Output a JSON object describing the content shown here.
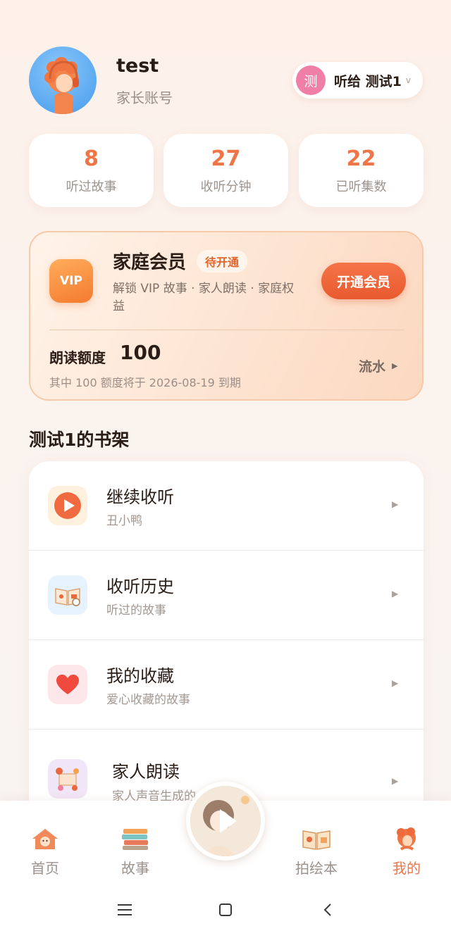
{
  "profile": {
    "username": "test",
    "account_type": "家长账号",
    "listen_to": {
      "avatar_char": "测",
      "label": "听给 测试1"
    }
  },
  "stats": [
    {
      "value": "8",
      "label": "听过故事"
    },
    {
      "value": "27",
      "label": "收听分钟"
    },
    {
      "value": "22",
      "label": "已听集数"
    }
  ],
  "vip": {
    "badge": "VIP",
    "title": "家庭会员",
    "status_tag": "待开通",
    "description": "解锁 VIP 故事 · 家人朗读 · 家庭权益",
    "button": "开通会员",
    "quota_label": "朗读额度",
    "quota_value": "100",
    "quota_note": "其中 100 额度将于 2026-08-19 到期",
    "flow_link": "流水"
  },
  "shelf": {
    "title": "测试1的书架",
    "items": [
      {
        "title": "继续收听",
        "subtitle": "丑小鸭",
        "icon": "play-icon"
      },
      {
        "title": "收听历史",
        "subtitle": "听过的故事",
        "icon": "history-book-icon"
      },
      {
        "title": "我的收藏",
        "subtitle": "爱心收藏的故事",
        "icon": "heart-icon"
      },
      {
        "title": "家人朗读",
        "subtitle": "家人声音生成的",
        "icon": "family-read-icon"
      }
    ]
  },
  "nav": {
    "items": [
      {
        "label": "首页",
        "icon": "home-icon"
      },
      {
        "label": "故事",
        "icon": "books-icon"
      },
      {
        "label": "拍绘本",
        "icon": "picture-book-icon"
      },
      {
        "label": "我的",
        "icon": "profile-icon",
        "active": true
      }
    ],
    "center_icon": "play-icon"
  },
  "colors": {
    "accent": "#ee7548",
    "vip_button": "#e85a2f",
    "pill_avatar": "#ef7fa6"
  }
}
